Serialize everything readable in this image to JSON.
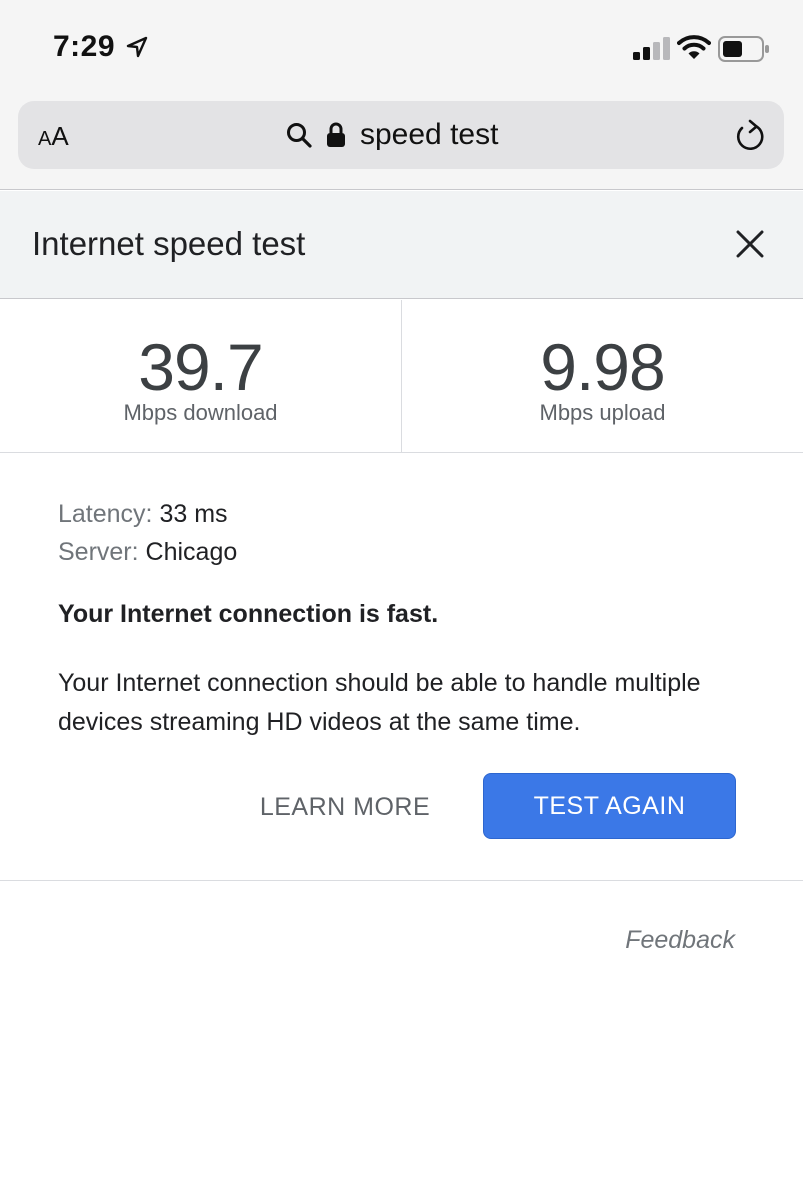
{
  "status_bar": {
    "time": "7:29"
  },
  "address_bar": {
    "text_size_small": "A",
    "text_size_large": "A",
    "url_text": "speed test"
  },
  "sheet": {
    "title": "Internet speed test"
  },
  "speed": {
    "download": {
      "value": "39.7",
      "unit": "Mbps download"
    },
    "upload": {
      "value": "9.98",
      "unit": "Mbps upload"
    }
  },
  "details": {
    "latency_label": "Latency:",
    "latency_value": "33 ms",
    "server_label": "Server:",
    "server_value": "Chicago"
  },
  "verdict": "Your Internet connection is fast.",
  "description": "Your Internet connection should be able to handle multiple devices streaming HD videos at the same time.",
  "actions": {
    "learn_more": "LEARN MORE",
    "test_again": "TEST AGAIN"
  },
  "feedback": "Feedback",
  "colors": {
    "primary_button": "#3b78e7",
    "panel_header": "#f1f3f4"
  },
  "icons": [
    "location-arrow-icon",
    "cellular-signal-icon",
    "wifi-icon",
    "battery-icon",
    "search-icon",
    "lock-icon",
    "reload-icon",
    "close-icon"
  ]
}
